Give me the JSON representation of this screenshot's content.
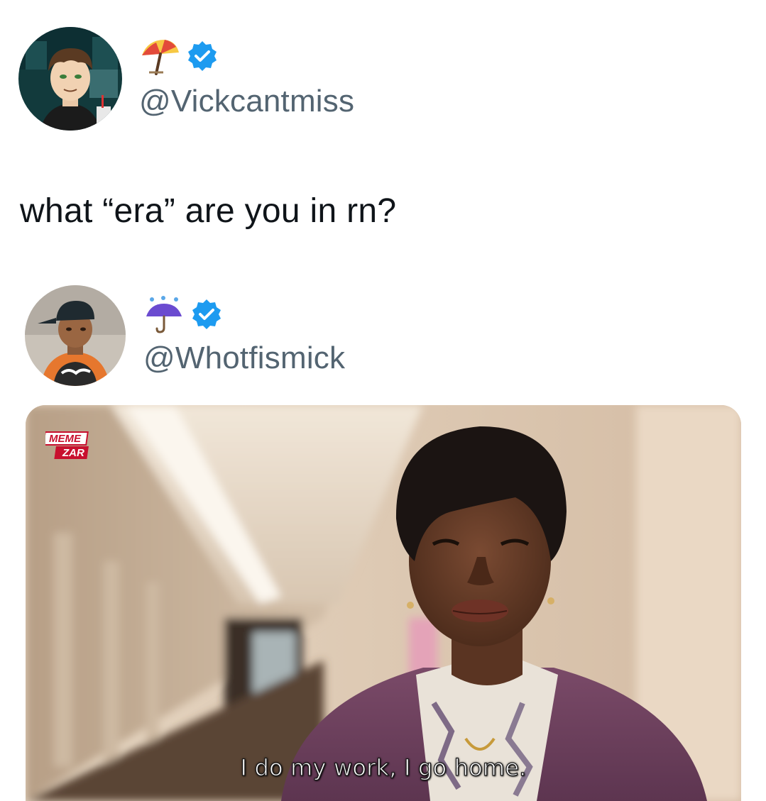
{
  "tweets": [
    {
      "handle": "@Vickcantmiss",
      "emoji": "beach-umbrella-icon",
      "verified": true,
      "text": "what  “era” are you in rn?"
    },
    {
      "handle": "@Whotfismick",
      "emoji": "umbrella-with-rain-drops-icon",
      "verified": true,
      "media": {
        "caption": "I do my work, I go home.",
        "watermark_line1": "MEME",
        "watermark_line2": "ZAR"
      }
    }
  ],
  "colors": {
    "verified_badge": "#1d9bf0",
    "handle_text": "#536471",
    "body_text": "#0f1419"
  }
}
